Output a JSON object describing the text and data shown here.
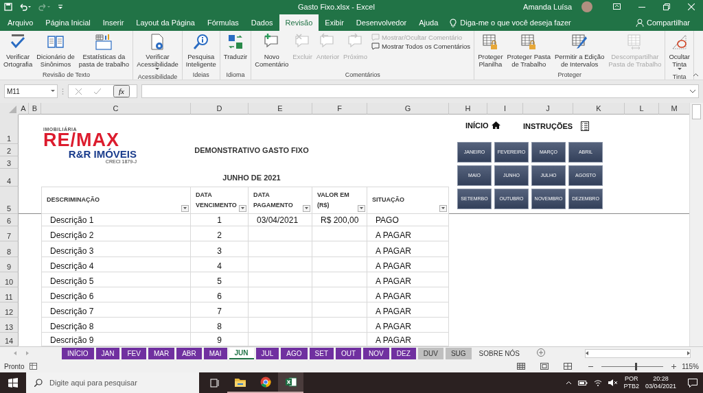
{
  "window": {
    "title": "Gasto Fixo.xlsx  -  Excel",
    "user": "Amanda Luísa"
  },
  "ribbon_tabs": [
    {
      "label": "Arquivo",
      "selected": false
    },
    {
      "label": "Página Inicial",
      "selected": false
    },
    {
      "label": "Inserir",
      "selected": false
    },
    {
      "label": "Layout da Página",
      "selected": false
    },
    {
      "label": "Fórmulas",
      "selected": false
    },
    {
      "label": "Dados",
      "selected": false
    },
    {
      "label": "Revisão",
      "selected": true
    },
    {
      "label": "Exibir",
      "selected": false
    },
    {
      "label": "Desenvolvedor",
      "selected": false
    },
    {
      "label": "Ajuda",
      "selected": false
    }
  ],
  "tell_me": "Diga-me o que você deseja fazer",
  "share": "Compartilhar",
  "ribbon_groups": [
    {
      "label": "Revisão de Texto",
      "commands": [
        {
          "kind": "large",
          "lines": [
            "Verificar",
            "Ortografia"
          ],
          "disabled": false
        },
        {
          "kind": "large",
          "lines": [
            "Dicionário de",
            "Sinônimos"
          ],
          "disabled": false
        },
        {
          "kind": "large",
          "lines": [
            "Estatísticas da",
            "pasta de trabalho"
          ],
          "disabled": false
        }
      ]
    },
    {
      "label": "Acessibilidade",
      "commands": [
        {
          "kind": "large",
          "lines": [
            "Verificar",
            "Acessibilidade"
          ],
          "disabled": false,
          "dropdown": true
        }
      ]
    },
    {
      "label": "Ideias",
      "commands": [
        {
          "kind": "large",
          "lines": [
            "Pesquisa",
            "Inteligente"
          ],
          "disabled": false
        }
      ]
    },
    {
      "label": "Idioma",
      "commands": [
        {
          "kind": "large",
          "lines": [
            "Traduzir"
          ],
          "disabled": false
        }
      ]
    },
    {
      "label": "Comentários",
      "commands": [
        {
          "kind": "large",
          "lines": [
            "Novo",
            "Comentário"
          ],
          "disabled": false
        },
        {
          "kind": "large",
          "lines": [
            "Excluir"
          ],
          "disabled": true
        },
        {
          "kind": "large",
          "lines": [
            "Anterior"
          ],
          "disabled": true
        },
        {
          "kind": "large",
          "lines": [
            "Próximo"
          ],
          "disabled": true
        },
        {
          "kind": "small",
          "lines": [
            "Mostrar/Ocultar Comentário"
          ],
          "disabled": true
        },
        {
          "kind": "small",
          "lines": [
            "Mostrar Todos os Comentários"
          ],
          "disabled": false
        }
      ]
    },
    {
      "label": "Proteger",
      "commands": [
        {
          "kind": "large",
          "lines": [
            "Proteger",
            "Planilha"
          ],
          "disabled": false
        },
        {
          "kind": "large",
          "lines": [
            "Proteger Pasta",
            "de Trabalho"
          ],
          "disabled": false
        },
        {
          "kind": "large",
          "lines": [
            "Permitir a Edição",
            "de Intervalos"
          ],
          "disabled": false
        },
        {
          "kind": "large",
          "lines": [
            "Descompartilhar",
            "Pasta de Trabalho"
          ],
          "disabled": true
        }
      ]
    },
    {
      "label": "Tinta",
      "commands": [
        {
          "kind": "large",
          "lines": [
            "Ocultar",
            "Tinta"
          ],
          "disabled": false,
          "dropdown": true
        }
      ]
    }
  ],
  "formula_bar": {
    "name_box": "M11",
    "function_label": "fx"
  },
  "columns": [
    "A",
    "B",
    "C",
    "D",
    "E",
    "F",
    "G",
    "H",
    "I",
    "J",
    "K",
    "L",
    "M"
  ],
  "row_numbers": [
    "1",
    "2",
    "3",
    "4",
    "5",
    "6",
    "7",
    "8",
    "9",
    "10",
    "11",
    "12",
    "13",
    "14"
  ],
  "sheet": {
    "logo": {
      "top_line": "IMOBILIÁRIA",
      "brand": "RE/MAX",
      "name": "R&R IMÓVEIS",
      "registration": "CRECI 1879-J"
    },
    "title": "DEMONSTRATIVO GASTO FIXO",
    "subtitle": "JUNHO DE 2021",
    "table": {
      "columns": [
        {
          "lines": [
            "DESCRIMINAÇÃO"
          ]
        },
        {
          "lines": [
            "DATA",
            "VENCIMENTO"
          ]
        },
        {
          "lines": [
            "DATA",
            "PAGAMENTO"
          ]
        },
        {
          "lines": [
            "VALOR EM",
            "(R$)"
          ]
        },
        {
          "lines": [
            "SITUAÇÃO"
          ]
        }
      ],
      "rows": [
        [
          "Descrição 1",
          "1",
          "03/04/2021",
          "R$ 200,00",
          "PAGO"
        ],
        [
          "Descrição 2",
          "2",
          "",
          "",
          "A PAGAR"
        ],
        [
          "Descrição 3",
          "3",
          "",
          "",
          "A PAGAR"
        ],
        [
          "Descrição 4",
          "4",
          "",
          "",
          "A PAGAR"
        ],
        [
          "Descrição 5",
          "5",
          "",
          "",
          "A PAGAR"
        ],
        [
          "Descrição 6",
          "6",
          "",
          "",
          "A PAGAR"
        ],
        [
          "Descrição 7",
          "7",
          "",
          "",
          "A PAGAR"
        ],
        [
          "Descrição 8",
          "8",
          "",
          "",
          "A PAGAR"
        ],
        [
          "Descrição 9",
          "9",
          "",
          "",
          "A PAGAR"
        ]
      ]
    },
    "nav": {
      "home": "INÍCIO",
      "instructions": "INSTRUÇÕES",
      "months": [
        "JANEIRO",
        "FEVEREIRO",
        "MARÇO",
        "ABRIL",
        "MAIO",
        "JUNHO",
        "JULHO",
        "AGOSTO",
        "SETEMRBO",
        "OUTUBRO",
        "NOVEMBRO",
        "DEZEMBRO"
      ]
    }
  },
  "sheet_tabs": [
    {
      "label": "INÍCIO",
      "color": "#7030a0",
      "selected": false
    },
    {
      "label": "JAN",
      "color": "#7030a0",
      "selected": false
    },
    {
      "label": "FEV",
      "color": "#7030a0",
      "selected": false
    },
    {
      "label": "MAR",
      "color": "#7030a0",
      "selected": false
    },
    {
      "label": "ABR",
      "color": "#7030a0",
      "selected": false
    },
    {
      "label": "MAI",
      "color": "#7030a0",
      "selected": false
    },
    {
      "label": "JUN",
      "selected": true
    },
    {
      "label": "JUL",
      "color": "#7030a0",
      "selected": false
    },
    {
      "label": "AGO",
      "color": "#7030a0",
      "selected": false
    },
    {
      "label": "SET",
      "color": "#7030a0",
      "selected": false
    },
    {
      "label": "OUT",
      "color": "#7030a0",
      "selected": false
    },
    {
      "label": "NOV",
      "color": "#7030a0",
      "selected": false
    },
    {
      "label": "DEZ",
      "color": "#7030a0",
      "selected": false
    },
    {
      "label": "DUV",
      "color": "#bfbfbf",
      "selected": false
    },
    {
      "label": "SUG",
      "color": "#bfbfbf",
      "selected": false
    },
    {
      "label": "SOBRE NÓS",
      "selected": false
    }
  ],
  "status_bar": {
    "status": "Pronto",
    "zoom_slider": {
      "level": 0.55
    },
    "zoom": "115%"
  },
  "taskbar": {
    "search_placeholder": "Digite aqui para pesquisar",
    "language": "POR",
    "layout": "PTB2",
    "time": "20:28",
    "date": "03/04/2021"
  }
}
